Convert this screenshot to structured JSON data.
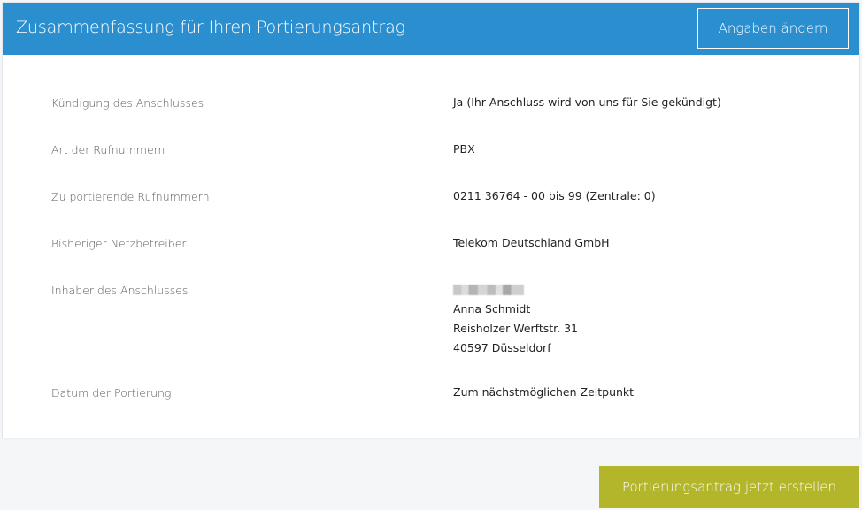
{
  "header": {
    "title": "Zusammenfassung für Ihren Portierungsantrag",
    "edit_label": "Angaben ändern"
  },
  "rows": [
    {
      "label": "Kündigung des Anschlusses",
      "value": "Ja  (Ihr Anschluss wird von uns für Sie gekündigt)"
    },
    {
      "label": "Art der Rufnummern",
      "value": "PBX"
    },
    {
      "label": "Zu portierende Rufnummern",
      "value": "0211 36764 - 00 bis 99 (Zentrale: 0)"
    },
    {
      "label": "Bisheriger Netzbetreiber",
      "value": "Telekom Deutschland GmbH"
    },
    {
      "label": "Inhaber des Anschlusses",
      "lines": [
        "Anna Schmidt",
        "Reisholzer Werftstr. 31",
        "40597 Düsseldorf"
      ]
    },
    {
      "label": "Datum der Portierung",
      "value": "Zum nächstmöglichen Zeitpunkt"
    }
  ],
  "footer": {
    "submit_label": "Portierungsantrag jetzt erstellen"
  },
  "colors": {
    "header_bg": "#2b8ecf",
    "submit_bg": "#b3b52a"
  }
}
